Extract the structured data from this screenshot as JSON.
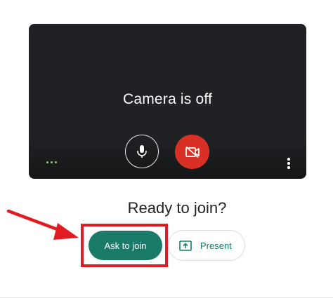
{
  "preview": {
    "camera_status": "Camera is off"
  },
  "controls": {
    "mic_icon": "microphone-icon",
    "camera_icon": "camera-off-icon",
    "effects_icon": "visual-effects-icon",
    "more_icon": "more-options-icon"
  },
  "join": {
    "title": "Ready to join?",
    "ask_label": "Ask to join",
    "present_label": "Present",
    "present_icon": "present-screen-icon"
  },
  "annotation": {
    "highlight_color": "#e21b23"
  },
  "colors": {
    "preview_bg": "#202124",
    "camera_off_red": "#d93025",
    "primary_green": "#1a7a68"
  }
}
